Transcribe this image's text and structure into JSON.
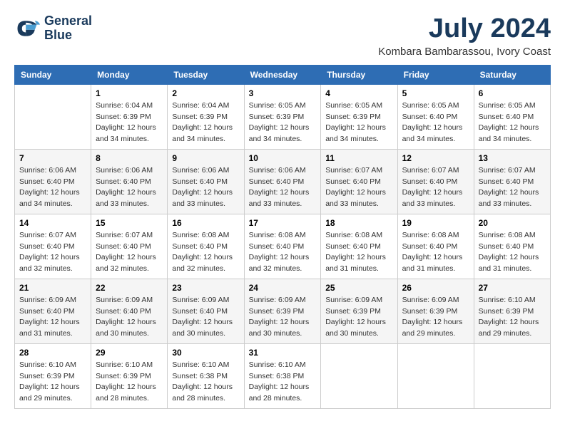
{
  "header": {
    "logo_line1": "General",
    "logo_line2": "Blue",
    "month_title": "July 2024",
    "location": "Kombara Bambarassou, Ivory Coast"
  },
  "days_of_week": [
    "Sunday",
    "Monday",
    "Tuesday",
    "Wednesday",
    "Thursday",
    "Friday",
    "Saturday"
  ],
  "weeks": [
    [
      {
        "day": "",
        "info": ""
      },
      {
        "day": "1",
        "info": "Sunrise: 6:04 AM\nSunset: 6:39 PM\nDaylight: 12 hours\nand 34 minutes."
      },
      {
        "day": "2",
        "info": "Sunrise: 6:04 AM\nSunset: 6:39 PM\nDaylight: 12 hours\nand 34 minutes."
      },
      {
        "day": "3",
        "info": "Sunrise: 6:05 AM\nSunset: 6:39 PM\nDaylight: 12 hours\nand 34 minutes."
      },
      {
        "day": "4",
        "info": "Sunrise: 6:05 AM\nSunset: 6:39 PM\nDaylight: 12 hours\nand 34 minutes."
      },
      {
        "day": "5",
        "info": "Sunrise: 6:05 AM\nSunset: 6:40 PM\nDaylight: 12 hours\nand 34 minutes."
      },
      {
        "day": "6",
        "info": "Sunrise: 6:05 AM\nSunset: 6:40 PM\nDaylight: 12 hours\nand 34 minutes."
      }
    ],
    [
      {
        "day": "7",
        "info": "Sunrise: 6:06 AM\nSunset: 6:40 PM\nDaylight: 12 hours\nand 34 minutes."
      },
      {
        "day": "8",
        "info": "Sunrise: 6:06 AM\nSunset: 6:40 PM\nDaylight: 12 hours\nand 33 minutes."
      },
      {
        "day": "9",
        "info": "Sunrise: 6:06 AM\nSunset: 6:40 PM\nDaylight: 12 hours\nand 33 minutes."
      },
      {
        "day": "10",
        "info": "Sunrise: 6:06 AM\nSunset: 6:40 PM\nDaylight: 12 hours\nand 33 minutes."
      },
      {
        "day": "11",
        "info": "Sunrise: 6:07 AM\nSunset: 6:40 PM\nDaylight: 12 hours\nand 33 minutes."
      },
      {
        "day": "12",
        "info": "Sunrise: 6:07 AM\nSunset: 6:40 PM\nDaylight: 12 hours\nand 33 minutes."
      },
      {
        "day": "13",
        "info": "Sunrise: 6:07 AM\nSunset: 6:40 PM\nDaylight: 12 hours\nand 33 minutes."
      }
    ],
    [
      {
        "day": "14",
        "info": "Sunrise: 6:07 AM\nSunset: 6:40 PM\nDaylight: 12 hours\nand 32 minutes."
      },
      {
        "day": "15",
        "info": "Sunrise: 6:07 AM\nSunset: 6:40 PM\nDaylight: 12 hours\nand 32 minutes."
      },
      {
        "day": "16",
        "info": "Sunrise: 6:08 AM\nSunset: 6:40 PM\nDaylight: 12 hours\nand 32 minutes."
      },
      {
        "day": "17",
        "info": "Sunrise: 6:08 AM\nSunset: 6:40 PM\nDaylight: 12 hours\nand 32 minutes."
      },
      {
        "day": "18",
        "info": "Sunrise: 6:08 AM\nSunset: 6:40 PM\nDaylight: 12 hours\nand 31 minutes."
      },
      {
        "day": "19",
        "info": "Sunrise: 6:08 AM\nSunset: 6:40 PM\nDaylight: 12 hours\nand 31 minutes."
      },
      {
        "day": "20",
        "info": "Sunrise: 6:08 AM\nSunset: 6:40 PM\nDaylight: 12 hours\nand 31 minutes."
      }
    ],
    [
      {
        "day": "21",
        "info": "Sunrise: 6:09 AM\nSunset: 6:40 PM\nDaylight: 12 hours\nand 31 minutes."
      },
      {
        "day": "22",
        "info": "Sunrise: 6:09 AM\nSunset: 6:40 PM\nDaylight: 12 hours\nand 30 minutes."
      },
      {
        "day": "23",
        "info": "Sunrise: 6:09 AM\nSunset: 6:40 PM\nDaylight: 12 hours\nand 30 minutes."
      },
      {
        "day": "24",
        "info": "Sunrise: 6:09 AM\nSunset: 6:39 PM\nDaylight: 12 hours\nand 30 minutes."
      },
      {
        "day": "25",
        "info": "Sunrise: 6:09 AM\nSunset: 6:39 PM\nDaylight: 12 hours\nand 30 minutes."
      },
      {
        "day": "26",
        "info": "Sunrise: 6:09 AM\nSunset: 6:39 PM\nDaylight: 12 hours\nand 29 minutes."
      },
      {
        "day": "27",
        "info": "Sunrise: 6:10 AM\nSunset: 6:39 PM\nDaylight: 12 hours\nand 29 minutes."
      }
    ],
    [
      {
        "day": "28",
        "info": "Sunrise: 6:10 AM\nSunset: 6:39 PM\nDaylight: 12 hours\nand 29 minutes."
      },
      {
        "day": "29",
        "info": "Sunrise: 6:10 AM\nSunset: 6:39 PM\nDaylight: 12 hours\nand 28 minutes."
      },
      {
        "day": "30",
        "info": "Sunrise: 6:10 AM\nSunset: 6:38 PM\nDaylight: 12 hours\nand 28 minutes."
      },
      {
        "day": "31",
        "info": "Sunrise: 6:10 AM\nSunset: 6:38 PM\nDaylight: 12 hours\nand 28 minutes."
      },
      {
        "day": "",
        "info": ""
      },
      {
        "day": "",
        "info": ""
      },
      {
        "day": "",
        "info": ""
      }
    ]
  ]
}
